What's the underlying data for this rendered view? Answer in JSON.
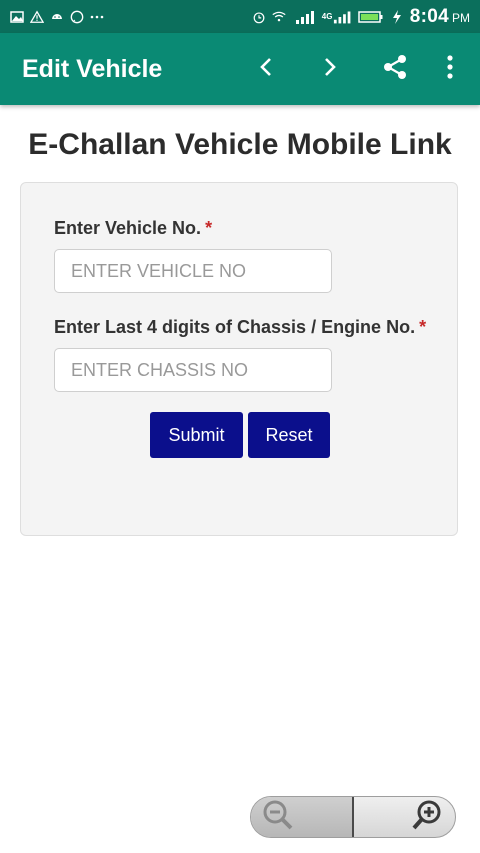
{
  "status_bar": {
    "time": "8:04",
    "ampm": "PM",
    "network_label": "4G"
  },
  "app_bar": {
    "title": "Edit Vehicle",
    "icons": [
      "back-chevron-icon",
      "forward-chevron-icon",
      "share-icon",
      "more-vert-icon"
    ]
  },
  "page": {
    "title": "E-Challan Vehicle Mobile Link"
  },
  "form": {
    "vehicle_label": "Enter Vehicle No.",
    "vehicle_required": "*",
    "vehicle_placeholder": "ENTER VEHICLE NO",
    "vehicle_value": "",
    "chassis_label": "Enter Last 4 digits of Chassis / Engine No.",
    "chassis_required": "*",
    "chassis_placeholder": "ENTER CHASSIS NO",
    "chassis_value": "",
    "submit_label": "Submit",
    "reset_label": "Reset"
  },
  "zoom_control": {
    "icons": [
      "zoom-out-icon",
      "zoom-in-icon"
    ]
  },
  "colors": {
    "status_bar": "#0b6f5c",
    "app_bar": "#0a8a74",
    "button": "#0b0f8c",
    "required": "#c62828"
  }
}
